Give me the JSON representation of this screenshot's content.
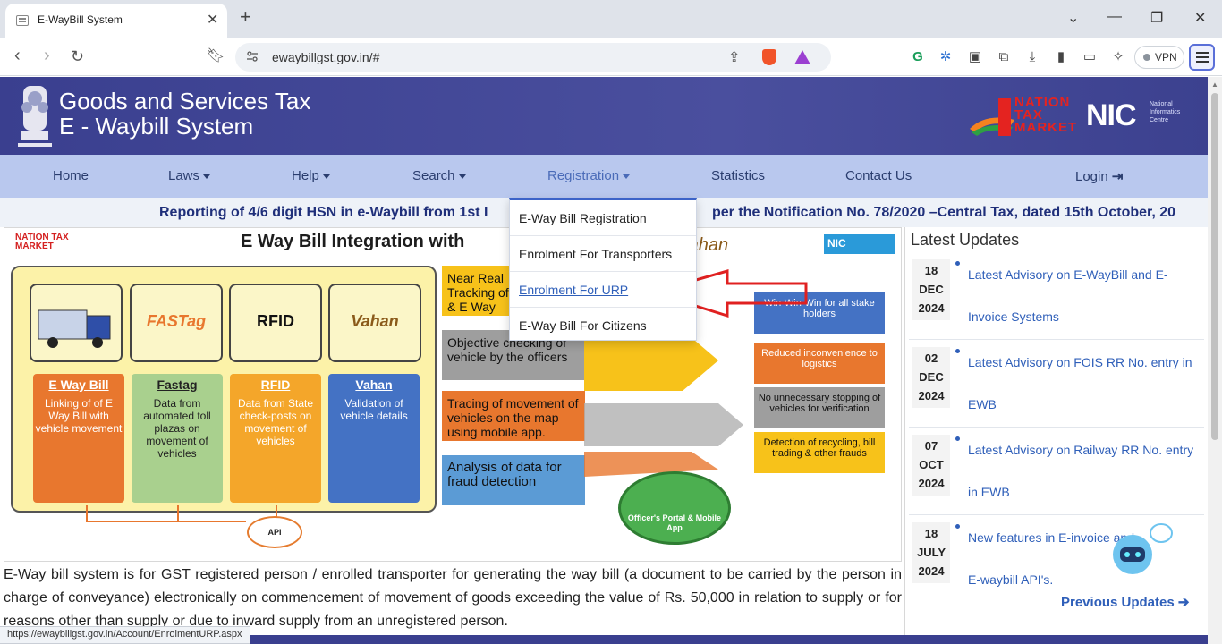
{
  "browser": {
    "tab_title": "E-WayBill System",
    "url": "ewaybillgst.gov.in/#",
    "vpn_label": "VPN",
    "status_url": "https://ewaybillgst.gov.in/Account/EnrolmentURP.aspx"
  },
  "header": {
    "title_line1": "Goods and Services Tax",
    "title_line2": "E - Waybill System",
    "partner_logo_text": "NATION TAX MARKET",
    "nic_logo": "NIC",
    "nic_sub": "National Informatics Centre"
  },
  "nav": {
    "items": [
      {
        "label": "Home"
      },
      {
        "label": "Laws"
      },
      {
        "label": "Help"
      },
      {
        "label": "Search"
      },
      {
        "label": "Registration"
      },
      {
        "label": "Statistics"
      },
      {
        "label": "Contact Us"
      },
      {
        "label": "Login"
      }
    ]
  },
  "ticker": {
    "text": "Reporting of 4/6 digit HSN in e-Waybill from 1st I",
    "text_tail": "per the Notification No. 78/2020 –Central Tax, dated 15th October, 20"
  },
  "registration_dropdown": {
    "items": [
      {
        "label": "E-Way Bill Registration"
      },
      {
        "label": "Enrolment For Transporters"
      },
      {
        "label": "Enrolment For URP"
      },
      {
        "label": "E-Way Bill For Citizens"
      }
    ]
  },
  "infographic": {
    "title": "E Way Bill Integration with",
    "ntm": "NATION TAX MARKET",
    "nic": "NIC",
    "vahan_top": "Vahan",
    "cards": [
      "",
      "FASTag",
      "RFID",
      "Vahan"
    ],
    "columns": [
      {
        "heading": "E Way Bill",
        "text": "Linking of of E Way Bill with vehicle movement",
        "color": "#e8772e"
      },
      {
        "heading": "Fastag",
        "text": "Data from automated toll plazas on movement of vehicles",
        "color": "#a9d08e"
      },
      {
        "heading": "RFID",
        "text": "Data from State check-posts on movement of vehicles",
        "color": "#f4a62a"
      },
      {
        "heading": "Vahan",
        "text": "Validation of vehicle details",
        "color": "#4472c4"
      }
    ],
    "api_label": "API",
    "middle": [
      "Near Real Tracking of & E Way",
      "Objective checking of vehicle by the officers",
      "Tracing of movement of vehicles on the map using mobile app.",
      "Analysis of data for fraud detection"
    ],
    "right": [
      "Win-Win-Win for all stake holders",
      "Reduced inconvenience to logistics",
      "No unnecessary stopping of vehicles for verification",
      "Detection of recycling, bill trading & other frauds"
    ],
    "portal": "Officer's Portal & Mobile App"
  },
  "updates": {
    "title": "Latest Updates",
    "items": [
      {
        "day": "18",
        "month": "DEC",
        "year": "2024",
        "text": "Latest Advisory on E-WayBill and E-Invoice Systems"
      },
      {
        "day": "02",
        "month": "DEC",
        "year": "2024",
        "text": "Latest Advisory on FOIS RR No. entry in EWB"
      },
      {
        "day": "07",
        "month": "OCT",
        "year": "2024",
        "text": "Latest Advisory on Railway RR No. entry in EWB"
      },
      {
        "day": "18",
        "month": "JULY",
        "year": "2024",
        "text": "New features in E-invoice and E-waybill API's."
      }
    ],
    "previous": "Previous Updates"
  },
  "description": "E-Way bill system is for GST registered person / enrolled transporter for generating the way bill (a document to be carried by the person in charge of conveyance) electronically on commencement of movement of goods exceeding the value of Rs. 50,000 in relation to supply or for reasons other than supply or due to inward supply from an unregistered person."
}
